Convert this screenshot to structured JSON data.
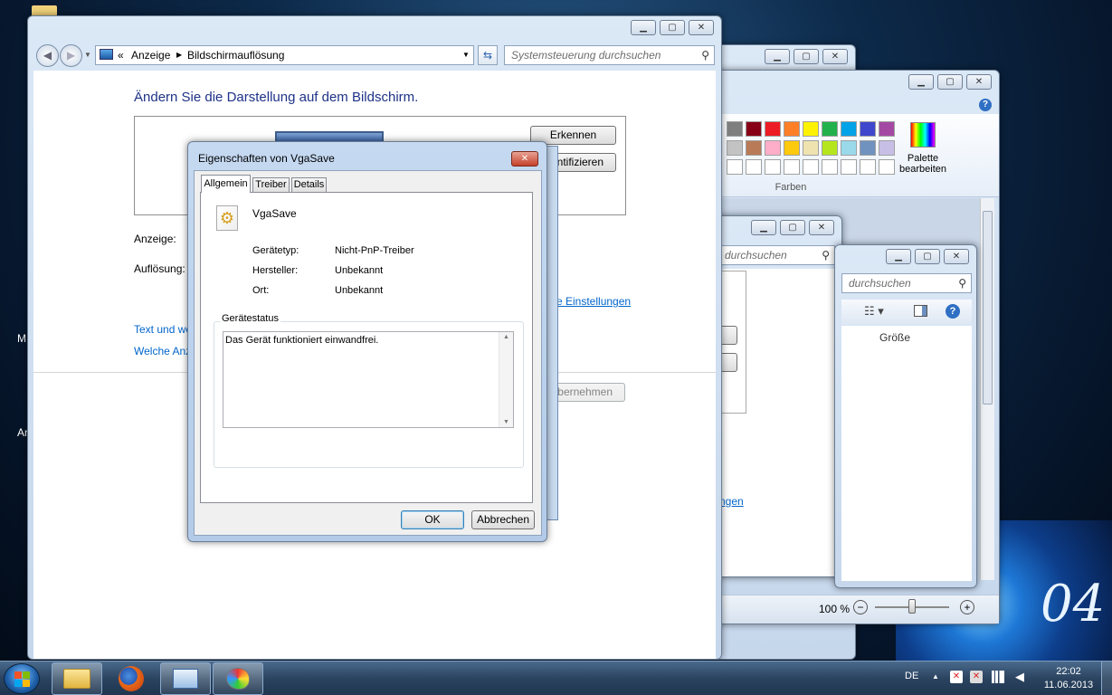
{
  "desktop": {
    "left_text_1": "M",
    "left_text_2": "Ar",
    "logo_text": "04"
  },
  "paint": {
    "colors_group_label": "Farben",
    "palette_label_1": "Palette",
    "palette_label_2": "bearbeiten",
    "palette_row1": [
      "#7f7f7f",
      "#880015",
      "#ed1c24",
      "#ff7f27",
      "#fff200",
      "#22b14c",
      "#00a2e8",
      "#3f48cc",
      "#a349a4"
    ],
    "palette_row2": [
      "#c3c3c3",
      "#b97a57",
      "#ffaec9",
      "#ffc90e",
      "#efe4b0",
      "#b5e61d",
      "#99d9ea",
      "#7092be",
      "#c8bfe7"
    ],
    "zoom_text": "100 %",
    "minus": "−",
    "plus": "+"
  },
  "explorer_mid": {
    "search_placeholder": "durchsuchen",
    "link": "ngen"
  },
  "explorer_right": {
    "search_placeholder": "durchsuchen",
    "column_size": "Größe"
  },
  "main": {
    "breadcrumb_sep": "«",
    "breadcrumb_1": "Anzeige",
    "breadcrumb_2": "Bildschirmauflösung",
    "search_placeholder": "Systemsteuerung durchsuchen",
    "heading": "Ändern Sie die Darstellung auf dem Bildschirm.",
    "detect_button": "Erkennen",
    "identify_button": "ntifizieren",
    "display_label": "Anzeige:",
    "resolution_label": "Auflösung:",
    "advanced_link": "e Einstellungen",
    "text_link": "Text und we",
    "which_link": "Welche Anz",
    "apply_button": "bernehmen"
  },
  "dialog": {
    "title": "Eigenschaften von VgaSave",
    "tabs": [
      "Allgemein",
      "Treiber",
      "Details"
    ],
    "device_name": "VgaSave",
    "props": [
      {
        "label": "Gerätetyp:",
        "value": "Nicht-PnP-Treiber"
      },
      {
        "label": "Hersteller:",
        "value": "Unbekannt"
      },
      {
        "label": "Ort:",
        "value": "Unbekannt"
      }
    ],
    "status_group": "Gerätestatus",
    "status_text": "Das Gerät funktioniert einwandfrei.",
    "ok_button": "OK",
    "cancel_button": "Abbrechen"
  },
  "taskbar": {
    "language": "DE",
    "time": "22:02",
    "date": "11.06.2013"
  }
}
